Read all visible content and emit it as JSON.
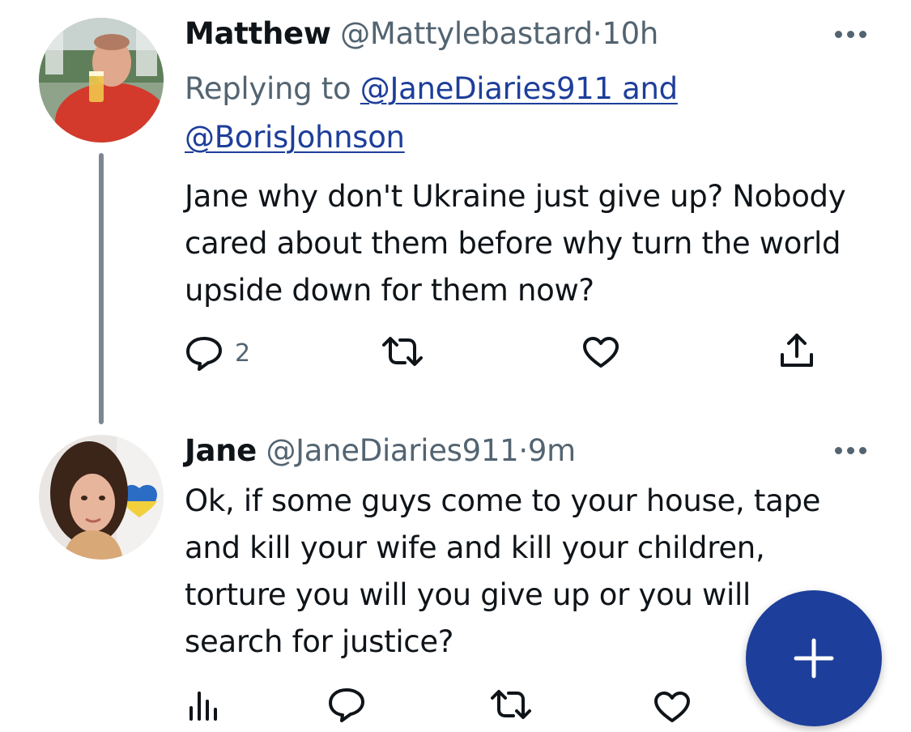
{
  "tweets": [
    {
      "name": "Matthew",
      "handle": "@Mattylebastard",
      "separator": "·",
      "time": "10h",
      "replying_prefix": "Replying to",
      "replying_to": [
        "@JaneDiaries911 and",
        "@BorisJohnson"
      ],
      "text": "Jane why don't Ukraine just give up? Nobody cared about them before why turn the world upside down for them now?",
      "reply_count": "2",
      "icons": [
        "reply-icon",
        "retweet-icon",
        "like-icon",
        "share-icon"
      ]
    },
    {
      "name": "Jane",
      "handle": "@JaneDiaries911",
      "separator": "·",
      "time": "9m",
      "text": "Ok, if some guys come to your house, tape and kill your wife and kill your children, torture you will you give up or you will search for justice?",
      "icons": [
        "analytics-icon",
        "reply-icon",
        "retweet-icon",
        "like-icon"
      ]
    }
  ],
  "compose_button": {
    "icon": "plus-icon"
  },
  "colors": {
    "link": "#1d3e9a",
    "secondary_text": "#536471",
    "fab": "#1d3e9a",
    "thread_line": "#7e8791"
  }
}
